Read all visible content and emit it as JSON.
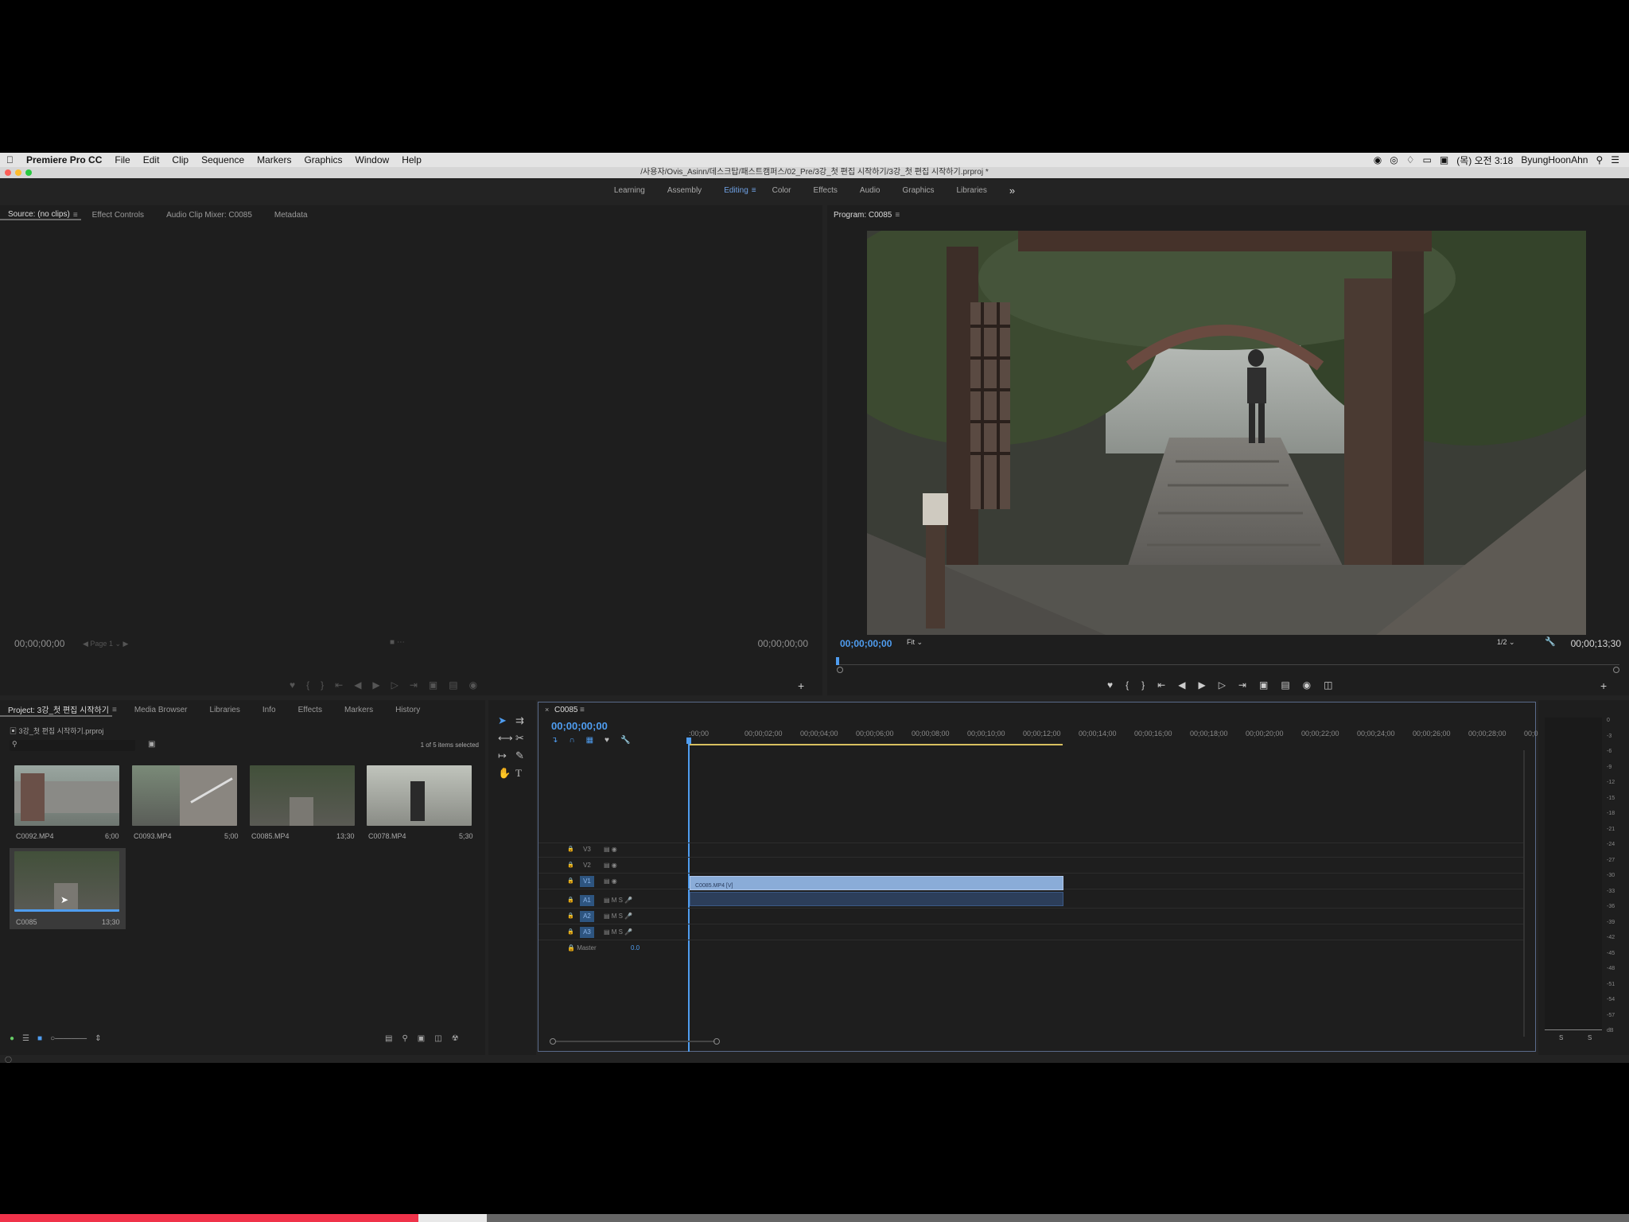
{
  "menubar": {
    "app": "Premiere Pro CC",
    "items": [
      "File",
      "Edit",
      "Clip",
      "Sequence",
      "Markers",
      "Graphics",
      "Window",
      "Help"
    ],
    "clock": "(목) 오전 3:18",
    "user": "ByungHoonAhn"
  },
  "title": "/사용자/Ovis_Asinn/데스크탑/패스트캠퍼스/02_Pre/3강_첫 편집 시작하기/3강_첫 편집 시작하기.prproj *",
  "workspaces": [
    "Learning",
    "Assembly",
    "Editing",
    "Color",
    "Effects",
    "Audio",
    "Graphics",
    "Libraries"
  ],
  "source": {
    "tabs": [
      "Source: (no clips)",
      "Effect Controls",
      "Audio Clip Mixer: C0085",
      "Metadata"
    ],
    "tc_left": "00;00;00;00",
    "page": "Page 1",
    "tc_right": "00;00;00;00"
  },
  "program": {
    "tab": "Program: C0085",
    "tc_left": "00;00;00;00",
    "fit": "Fit",
    "quality": "1/2",
    "tc_right": "00;00;13;30"
  },
  "project": {
    "tabs": [
      "Project: 3강_첫 편집 시작하기",
      "Media Browser",
      "Libraries",
      "Info",
      "Effects",
      "Markers",
      "History"
    ],
    "file": "3강_첫 편집 시작하기.prproj",
    "selection": "1 of 5 items selected",
    "clips": [
      {
        "name": "C0092.MP4",
        "dur": "6;00"
      },
      {
        "name": "C0093.MP4",
        "dur": "5;00"
      },
      {
        "name": "C0085.MP4",
        "dur": "13;30"
      },
      {
        "name": "C0078.MP4",
        "dur": "5;30"
      },
      {
        "name": "C0085",
        "dur": "13;30"
      }
    ]
  },
  "timeline": {
    "tab": "C0085",
    "tc": "00;00;00;00",
    "ruler": [
      ":00;00",
      "00;00;02;00",
      "00;00;04;00",
      "00;00;06;00",
      "00;00;08;00",
      "00;00;10;00",
      "00;00;12;00",
      "00;00;14;00",
      "00;00;16;00",
      "00;00;18;00",
      "00;00;20;00",
      "00;00;22;00",
      "00;00;24;00",
      "00;00;26;00",
      "00;00;28;00",
      "00;0("
    ],
    "video_tracks": [
      "V3",
      "V2",
      "V1"
    ],
    "audio_tracks": [
      "A1",
      "A2",
      "A3"
    ],
    "master": "Master",
    "master_val": "0.0",
    "clip_label": "C0085.MP4 [V]"
  },
  "meter": {
    "scale": [
      "0",
      "-3",
      "-6",
      "-9",
      "-12",
      "-15",
      "-18",
      "-21",
      "-24",
      "-27",
      "-30",
      "-33",
      "-36",
      "-39",
      "-42",
      "-45",
      "-48",
      "-51",
      "-54",
      "-57",
      "dB"
    ],
    "solo": [
      "S",
      "S"
    ]
  }
}
